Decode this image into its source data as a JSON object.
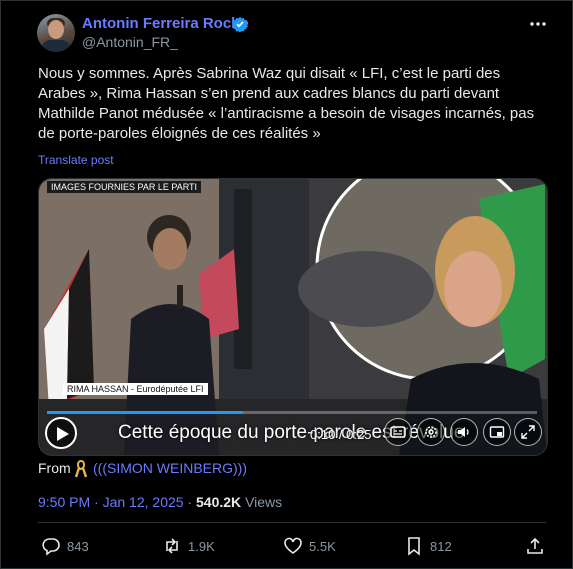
{
  "author": {
    "name": "Antonin Ferreira Roche",
    "handle": "@Antonin_FR_"
  },
  "tweet": {
    "text": "Nous y sommes. Après Sabrina Waz qui disait « LFI, c’est le parti des Arabes », Rima Hassan s’en prend aux cadres blancs du parti devant Mathilde Panot médusée « l’antiracisme a besoin de visages incarnés, pas de porte-paroles éloignés de ces réalités »",
    "translate_label": "Translate post"
  },
  "video": {
    "source_tag": "IMAGES FOURNIES PAR LE PARTI",
    "lower_third": "RIMA HASSAN - Eurodéputée LFI",
    "subtitle": "Cette époque du porte-parole est révolue",
    "timecode": "0:10 / 0:25",
    "progress": 0.4
  },
  "attribution": {
    "prefix": "From",
    "source": "(((SIMON WEINBERG)))"
  },
  "meta": {
    "time": "9:50 PM",
    "date": "Jan 12, 2025",
    "separator": " · ",
    "views": "540.2K",
    "views_label": "Views"
  },
  "actions": {
    "replies": "843",
    "reposts": "1.9K",
    "likes": "5.5K",
    "bookmarks": "812"
  },
  "colors": {
    "accent": "#6b7bff",
    "background": "#000000",
    "muted": "#8b98a5"
  }
}
